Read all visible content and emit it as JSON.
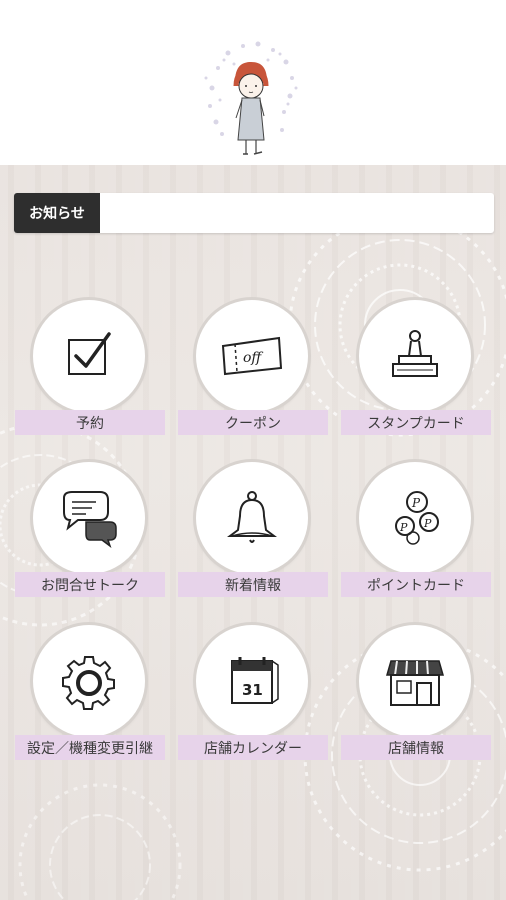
{
  "header": {
    "logo_icon": "girl-mascot-illustration"
  },
  "notice": {
    "label": "お知らせ",
    "content": ""
  },
  "menu": [
    {
      "label": "予約",
      "icon": "checkbox-icon"
    },
    {
      "label": "クーポン",
      "icon": "coupon-ticket-icon"
    },
    {
      "label": "スタンプカード",
      "icon": "stamp-icon"
    },
    {
      "label": "お問合せトーク",
      "icon": "chat-bubbles-icon"
    },
    {
      "label": "新着情報",
      "icon": "bell-icon"
    },
    {
      "label": "ポイントカード",
      "icon": "point-coins-icon"
    },
    {
      "label": "設定／機種変更引継",
      "icon": "gear-icon"
    },
    {
      "label": "店舗カレンダー",
      "icon": "calendar-icon"
    },
    {
      "label": "店舗情報",
      "icon": "shop-icon"
    }
  ],
  "colors": {
    "label_bg": "#e7d3ea",
    "notice_label_bg": "#2e2e2e",
    "background": "#e9e3df"
  }
}
